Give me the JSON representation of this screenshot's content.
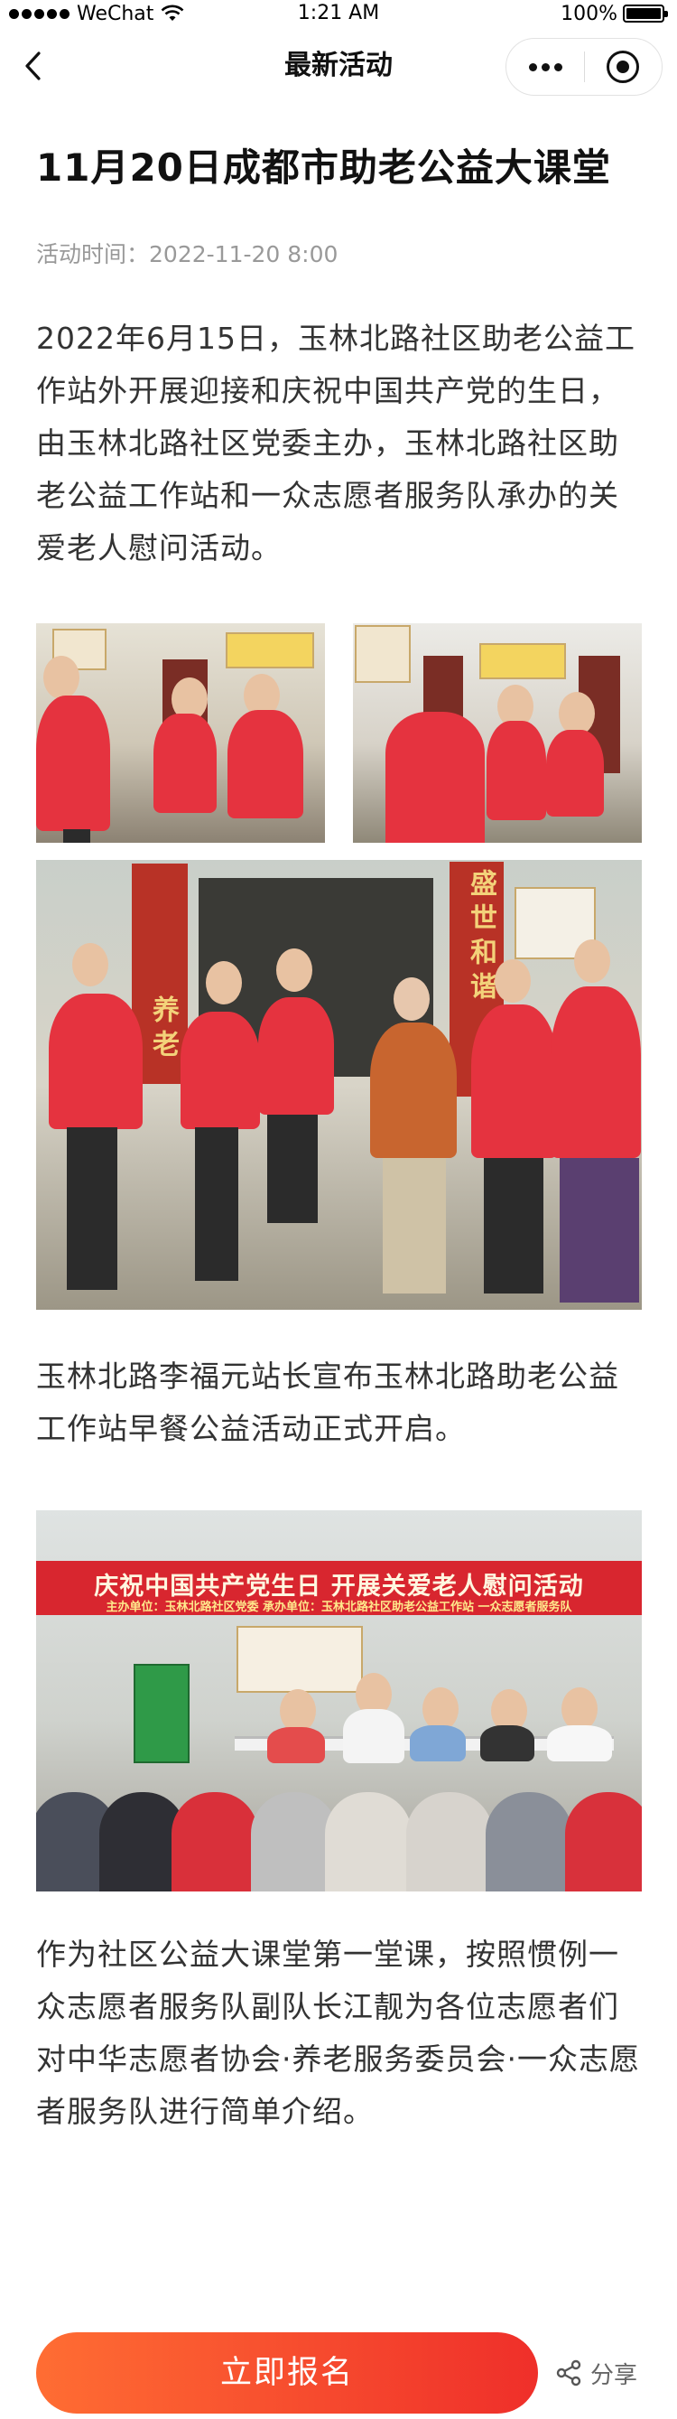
{
  "status_bar": {
    "carrier": "WeChat",
    "time": "1:21 AM",
    "battery": "100%",
    "battery_level": 1.0
  },
  "nav": {
    "title": "最新活动"
  },
  "article": {
    "title": "11月20日成都市助老公益大课堂",
    "meta_label": "活动时间：",
    "meta_value": "2022-11-20  8:00",
    "paragraphs": [
      "2022年6月15日，玉林北路社区助老公益工作站外开展迎接和庆祝中国共产党的生日，由玉林北路社区党委主办，玉林北路社区助老公益工作站和一众志愿者服务队承办的关爱老人慰问活动。",
      "玉林北路李福元站长宣布玉林北路助老公益工作站早餐公益活动正式开启。",
      "作为社区公益大课堂第一堂课，按照惯例一众志愿者服务队副队长江靓为各位志愿者们对中华志愿者协会·养老服务委员会·一众志愿者服务队进行简单介绍。"
    ]
  },
  "photos": {
    "couplet_left": "养老",
    "couplet_right": "盛世和谐",
    "banner_title": "庆祝中国共产党生日  开展关爱老人慰问活动",
    "banner_sub": "主办单位：玉林北路社区党委    承办单位：玉林北路社区助老公益工作站  一众志愿者服务队"
  },
  "footer": {
    "signup_label": "立即报名",
    "share_label": "分享"
  },
  "colors": {
    "accent_start": "#ff6d33",
    "accent_end": "#ef2f2a",
    "vest_red": "#e5333f"
  }
}
